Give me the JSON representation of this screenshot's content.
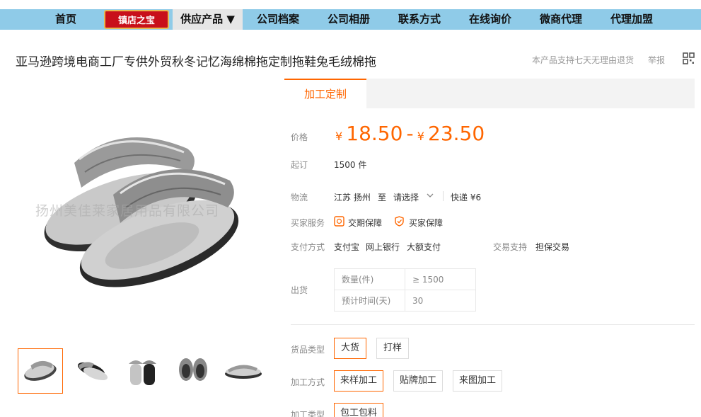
{
  "nav": {
    "home": "首页",
    "badge": "镇店之宝",
    "products": "供应产品 ▼",
    "profile": "公司档案",
    "album": "公司相册",
    "contact": "联系方式",
    "inquiry": "在线询价",
    "agent": "微商代理",
    "join": "代理加盟"
  },
  "product": {
    "title": "亚马逊跨境电商工厂专供外贸秋冬记忆海绵棉拖定制拖鞋兔毛绒棉拖",
    "return_policy": "本产品支持七天无理由退货",
    "report": "举报",
    "watermark": "扬州美佳莱家居用品有限公司"
  },
  "tab": {
    "label": "加工定制"
  },
  "price": {
    "label": "价格",
    "currency": "¥",
    "low": "18.50",
    "sep": "-",
    "high": "23.50"
  },
  "moq": {
    "label": "起订",
    "value": "1500 件"
  },
  "logistics": {
    "label": "物流",
    "origin": "江苏 扬州",
    "to": "至",
    "dest": "请选择",
    "express": "快递 ¥6"
  },
  "services": {
    "label": "买家服务",
    "item1": "交期保障",
    "item2": "买家保障"
  },
  "payment": {
    "label": "支付方式",
    "methods": [
      "支付宝",
      "网上银行",
      "大额支付"
    ],
    "trade_label": "交易支持",
    "trade_value": "担保交易"
  },
  "shipment": {
    "label": "出货",
    "rows": [
      {
        "k": "数量(件)",
        "v": "≥ 1500"
      },
      {
        "k": "预计时间(天)",
        "v": "30"
      }
    ]
  },
  "goods_type": {
    "label": "货品类型",
    "options": [
      "大货",
      "打样"
    ],
    "selected": "大货"
  },
  "process": {
    "label": "加工方式",
    "options": [
      "来样加工",
      "贴牌加工",
      "来图加工"
    ],
    "selected": "来样加工"
  },
  "process_type": {
    "label": "加工类型",
    "options": [
      "包工包料"
    ],
    "selected": "包工包料"
  },
  "colors": {
    "accent": "#ff6600",
    "nav_bg": "#8fcbe8",
    "badge": "#c8101a"
  },
  "icons": {
    "qr": "qr-code-icon",
    "dropdown": "chevron-down-icon",
    "service": "shield-icon"
  }
}
